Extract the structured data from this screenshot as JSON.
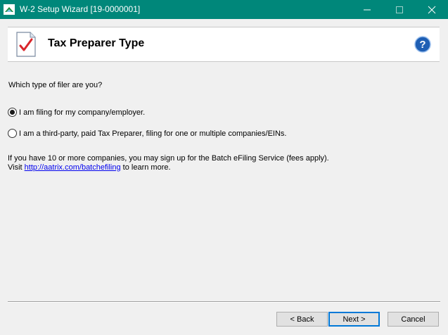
{
  "window": {
    "title": "W-2 Setup Wizard [19-0000001]",
    "accent": "#00877a"
  },
  "header": {
    "title": "Tax Preparer Type"
  },
  "question": "Which type of filer are you?",
  "options": [
    {
      "label": "I am filing for my company/employer.",
      "selected": true
    },
    {
      "label": "I am a third-party, paid Tax Preparer, filing for one or multiple companies/EINs.",
      "selected": false
    }
  ],
  "info": {
    "line1": "If you have 10 or more companies, you may sign up for the Batch eFiling Service (fees apply).",
    "visit": "Visit ",
    "link": "http://aatrix.com/batchefiling",
    "suffix": " to learn more."
  },
  "buttons": {
    "back": "< Back",
    "next": "Next >",
    "cancel": "Cancel"
  }
}
